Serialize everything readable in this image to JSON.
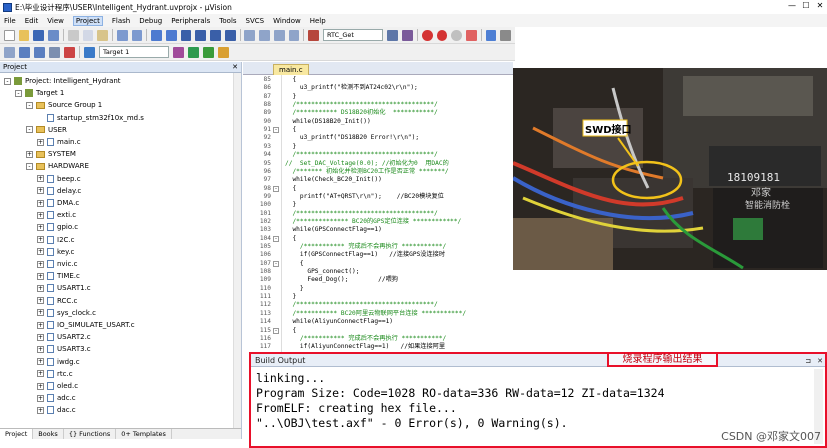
{
  "window": {
    "title": "E:\\毕业设计程序\\USER\\Intelligent_Hydrant.uvprojx - μVision",
    "min": "—",
    "max": "☐",
    "close": "✕"
  },
  "menu": [
    "File",
    "Edit",
    "View",
    "Project",
    "Flash",
    "Debug",
    "Peripherals",
    "Tools",
    "SVCS",
    "Window",
    "Help"
  ],
  "menu_active": "Project",
  "toolbar": {
    "function_combo": "RTC_Get",
    "target_combo": "Target 1"
  },
  "project": {
    "title": "Project",
    "close": "✕",
    "tree": [
      {
        "label": "Project: Intelligent_Hydrant",
        "indent": 0,
        "kind": "root",
        "exp": "-"
      },
      {
        "label": "Target 1",
        "indent": 1,
        "kind": "target",
        "exp": "-"
      },
      {
        "label": "Source Group 1",
        "indent": 2,
        "kind": "folder",
        "exp": "-"
      },
      {
        "label": "startup_stm32f10x_md.s",
        "indent": 3,
        "kind": "file",
        "exp": ""
      },
      {
        "label": "USER",
        "indent": 2,
        "kind": "folder",
        "exp": "-"
      },
      {
        "label": "main.c",
        "indent": 3,
        "kind": "file",
        "exp": "+"
      },
      {
        "label": "SYSTEM",
        "indent": 2,
        "kind": "folder",
        "exp": "+"
      },
      {
        "label": "HARDWARE",
        "indent": 2,
        "kind": "folder",
        "exp": "-"
      },
      {
        "label": "beep.c",
        "indent": 3,
        "kind": "file",
        "exp": "+"
      },
      {
        "label": "delay.c",
        "indent": 3,
        "kind": "file",
        "exp": "+"
      },
      {
        "label": "DMA.c",
        "indent": 3,
        "kind": "file",
        "exp": "+"
      },
      {
        "label": "exti.c",
        "indent": 3,
        "kind": "file",
        "exp": "+"
      },
      {
        "label": "gpio.c",
        "indent": 3,
        "kind": "file",
        "exp": "+"
      },
      {
        "label": "I2C.c",
        "indent": 3,
        "kind": "file",
        "exp": "+"
      },
      {
        "label": "key.c",
        "indent": 3,
        "kind": "file",
        "exp": "+"
      },
      {
        "label": "nvic.c",
        "indent": 3,
        "kind": "file",
        "exp": "+"
      },
      {
        "label": "TIME.c",
        "indent": 3,
        "kind": "file",
        "exp": "+"
      },
      {
        "label": "USART1.c",
        "indent": 3,
        "kind": "file",
        "exp": "+"
      },
      {
        "label": "RCC.c",
        "indent": 3,
        "kind": "file",
        "exp": "+"
      },
      {
        "label": "sys_clock.c",
        "indent": 3,
        "kind": "file",
        "exp": "+"
      },
      {
        "label": "IO_SIMULATE_USART.c",
        "indent": 3,
        "kind": "file",
        "exp": "+"
      },
      {
        "label": "USART2.c",
        "indent": 3,
        "kind": "file",
        "exp": "+"
      },
      {
        "label": "USART3.c",
        "indent": 3,
        "kind": "file",
        "exp": "+"
      },
      {
        "label": "iwdg.c",
        "indent": 3,
        "kind": "file",
        "exp": "+"
      },
      {
        "label": "rtc.c",
        "indent": 3,
        "kind": "file",
        "exp": "+"
      },
      {
        "label": "oled.c",
        "indent": 3,
        "kind": "file",
        "exp": "+"
      },
      {
        "label": "adc.c",
        "indent": 3,
        "kind": "file",
        "exp": "+"
      },
      {
        "label": "dac.c",
        "indent": 3,
        "kind": "file",
        "exp": "+"
      }
    ],
    "tabs": [
      "Project",
      "Books",
      "{} Functions",
      "0+ Templates"
    ]
  },
  "editor": {
    "tab": "main.c",
    "lines": [
      {
        "n": "85",
        "f": "",
        "t": "  {"
      },
      {
        "n": "86",
        "f": "",
        "t": "    u3_printf(\"检测不到AT24c02\\r\\n\");"
      },
      {
        "n": "87",
        "f": "",
        "t": "  }"
      },
      {
        "n": "88",
        "f": "",
        "t": "  /*************************************/"
      },
      {
        "n": "89",
        "f": "",
        "t": "  /*********** DS18B20初始化  ***********/"
      },
      {
        "n": "90",
        "f": "",
        "t": "  while(DS18B20_Init())"
      },
      {
        "n": "91",
        "f": "-",
        "t": "  {"
      },
      {
        "n": "92",
        "f": "",
        "t": "    u3_printf(\"DS18B20 Error!\\r\\n\");"
      },
      {
        "n": "93",
        "f": "",
        "t": "  }"
      },
      {
        "n": "94",
        "f": "",
        "t": "  /*************************************/"
      },
      {
        "n": "95",
        "f": "",
        "t": "//  Set_DAC_Voltage(0.0); //初始化为0  用DAC的"
      },
      {
        "n": "96",
        "f": "",
        "t": "  /******* 初始化并检测BC20工作是否正常 *******/"
      },
      {
        "n": "97",
        "f": "",
        "t": "  while(Check_BC20_Init())"
      },
      {
        "n": "98",
        "f": "-",
        "t": "  {"
      },
      {
        "n": "99",
        "f": "",
        "t": "    printf(\"AT+QRST\\r\\n\");    //BC20模块复位"
      },
      {
        "n": "100",
        "f": "",
        "t": "  }"
      },
      {
        "n": "101",
        "f": "",
        "t": "  /*************************************/"
      },
      {
        "n": "102",
        "f": "",
        "t": "  /************** BC20的GPS定位连接 ************/"
      },
      {
        "n": "103",
        "f": "",
        "t": "  while(GPSConnectFlag==1)"
      },
      {
        "n": "104",
        "f": "-",
        "t": "  {"
      },
      {
        "n": "105",
        "f": "",
        "t": "    /*********** 完成后不会再执行 ***********/"
      },
      {
        "n": "106",
        "f": "",
        "t": "    if(GPSConnectFlag==1)   //连接GPS没连接时"
      },
      {
        "n": "107",
        "f": "-",
        "t": "    {"
      },
      {
        "n": "108",
        "f": "",
        "t": "      GPS_connect();"
      },
      {
        "n": "109",
        "f": "",
        "t": "      Feed_Dog();        //喂狗"
      },
      {
        "n": "110",
        "f": "",
        "t": "    }"
      },
      {
        "n": "111",
        "f": "",
        "t": "  }"
      },
      {
        "n": "112",
        "f": "",
        "t": "  /*************************************/"
      },
      {
        "n": "113",
        "f": "",
        "t": "  /*********** BC20阿里云物联网平台连接 ***********/"
      },
      {
        "n": "114",
        "f": "",
        "t": "  while(AliyunConnectFlag==1)"
      },
      {
        "n": "115",
        "f": "-",
        "t": "  {"
      },
      {
        "n": "116",
        "f": "",
        "t": "    /*********** 完成后不会再执行 ***********/"
      },
      {
        "n": "117",
        "f": "",
        "t": "    if(AliyunConnectFlag==1)   //如果连接阿里"
      }
    ]
  },
  "photo": {
    "label": "SWD接口",
    "chip_text": "18109181",
    "board_text_1": "邓家",
    "board_text_2": "智能消防栓"
  },
  "build": {
    "title": "Build Output",
    "pin": "⊐",
    "close": "✕",
    "annotation": "烧录程序输出结果",
    "lines": [
      "linking...",
      "Program Size: Code=1028 RO-data=336 RW-data=12 ZI-data=1324",
      "FromELF: creating hex file...",
      "\"..\\OBJ\\test.axf\" - 0 Error(s), 0 Warning(s)."
    ]
  },
  "watermark": "CSDN @邓家文007",
  "colors": {
    "accent": "#e8102a",
    "folder": "#e8c15a",
    "panel": "#dce6f4"
  }
}
